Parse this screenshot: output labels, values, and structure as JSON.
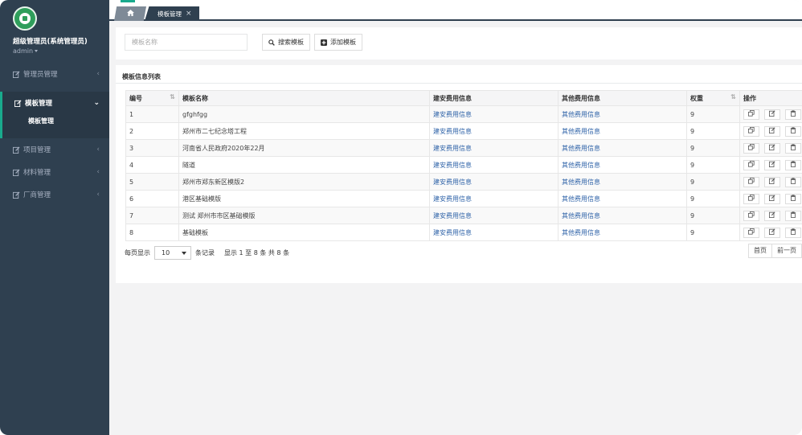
{
  "sidebar": {
    "profile": {
      "name": "超级管理员(系统管理员)",
      "role": "admin"
    },
    "items": [
      {
        "label": "管理员管理"
      },
      {
        "label": "模板管理"
      },
      {
        "label": "项目管理"
      },
      {
        "label": "材料管理"
      },
      {
        "label": "厂商管理"
      }
    ],
    "submenu": {
      "label": "模板管理"
    }
  },
  "tabs": {
    "active_label": "模板管理"
  },
  "search": {
    "placeholder": "模板名称",
    "search_button": "搜索模板",
    "add_button": "添加模板"
  },
  "list": {
    "title": "模板信息列表",
    "columns": [
      "编号",
      "模板名称",
      "建安费用信息",
      "其他费用信息",
      "权重",
      "操作"
    ],
    "rows": [
      {
        "id": "1",
        "name": "gfghfgg",
        "build": "建安费用信息",
        "other": "其他费用信息",
        "weight": "9"
      },
      {
        "id": "2",
        "name": "郑州市二七纪念塔工程",
        "build": "建安费用信息",
        "other": "其他费用信息",
        "weight": "9"
      },
      {
        "id": "3",
        "name": "河南省人民政府2020年22月",
        "build": "建安费用信息",
        "other": "其他费用信息",
        "weight": "9"
      },
      {
        "id": "4",
        "name": "隧道",
        "build": "建安费用信息",
        "other": "其他费用信息",
        "weight": "9"
      },
      {
        "id": "5",
        "name": "郑州市郑东新区模版2",
        "build": "建安费用信息",
        "other": "其他费用信息",
        "weight": "9"
      },
      {
        "id": "6",
        "name": "港区基础模版",
        "build": "建安费用信息",
        "other": "其他费用信息",
        "weight": "9"
      },
      {
        "id": "7",
        "name": "测试 郑州市市区基础模版",
        "build": "建安费用信息",
        "other": "其他费用信息",
        "weight": "9"
      },
      {
        "id": "8",
        "name": "基础模板",
        "build": "建安费用信息",
        "other": "其他费用信息",
        "weight": "9"
      }
    ]
  },
  "pagination": {
    "per_page_prefix": "每页显示",
    "per_page_value": "10",
    "per_page_suffix": "条记录",
    "info": "显示 1 至 8 条  共 8 条",
    "first_label": "首页",
    "prev_label": "前一页"
  },
  "colors": {
    "sidebar": "#2f4050",
    "accent": "#19aa8d",
    "link": "#2f63a8"
  }
}
